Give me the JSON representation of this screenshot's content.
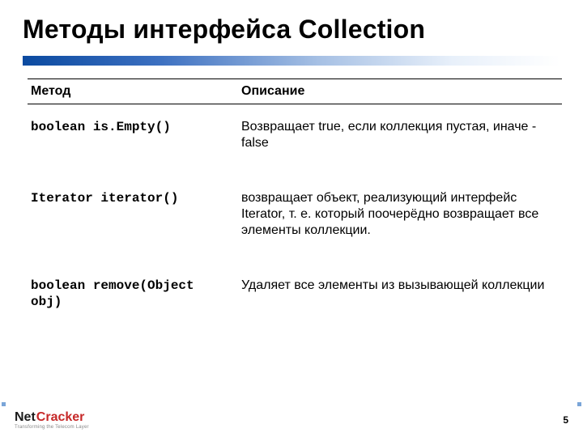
{
  "title": "Методы интерфейса Collection",
  "table": {
    "headers": {
      "method": "Метод",
      "description": "Описание"
    },
    "rows": [
      {
        "method": "boolean is.Empty()",
        "description": "Возвращает true, если коллекция пустая, иначе - false"
      },
      {
        "method": "Iterator iterator()",
        "description": "возвращает объект, реализующий интерфейс Iterator, т. е. который поочерёдно возвращает все элементы коллекции."
      },
      {
        "method": "boolean remove(Object obj)",
        "description": "Удаляет все элементы из вызывающей коллекции"
      }
    ]
  },
  "footer": {
    "logo_part1": "Net",
    "logo_part2": "Cracker",
    "tagline": "Transforming the Telecom Layer",
    "page": "5"
  }
}
